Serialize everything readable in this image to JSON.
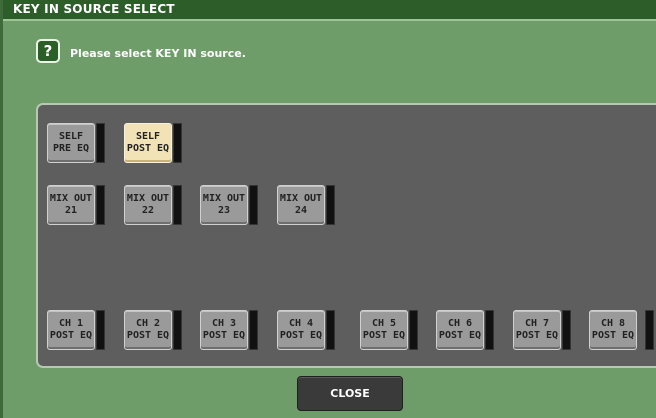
{
  "window": {
    "title": "KEY IN SOURCE SELECT"
  },
  "prompt": {
    "icon": "question-icon",
    "glyph": "?",
    "text": "Please select KEY IN source."
  },
  "sources": {
    "self": [
      {
        "label": "SELF\nPRE EQ",
        "selected": false
      },
      {
        "label": "SELF\nPOST EQ",
        "selected": true
      }
    ],
    "mix_out": [
      {
        "label": "MIX OUT\n21"
      },
      {
        "label": "MIX OUT\n22"
      },
      {
        "label": "MIX OUT\n23"
      },
      {
        "label": "MIX OUT\n24"
      }
    ],
    "channels": [
      {
        "label": "CH 1\nPOST EQ"
      },
      {
        "label": "CH 2\nPOST EQ"
      },
      {
        "label": "CH 3\nPOST EQ"
      },
      {
        "label": "CH 4\nPOST EQ"
      },
      {
        "label": "CH 5\nPOST EQ"
      },
      {
        "label": "CH 6\nPOST EQ"
      },
      {
        "label": "CH 7\nPOST EQ"
      },
      {
        "label": "CH 8\nPOST EQ"
      }
    ]
  },
  "footer": {
    "close_label": "CLOSE"
  },
  "colors": {
    "selected": "#f2e3b6",
    "panel": "#5e5e5e",
    "window": "#6f9d6a"
  }
}
